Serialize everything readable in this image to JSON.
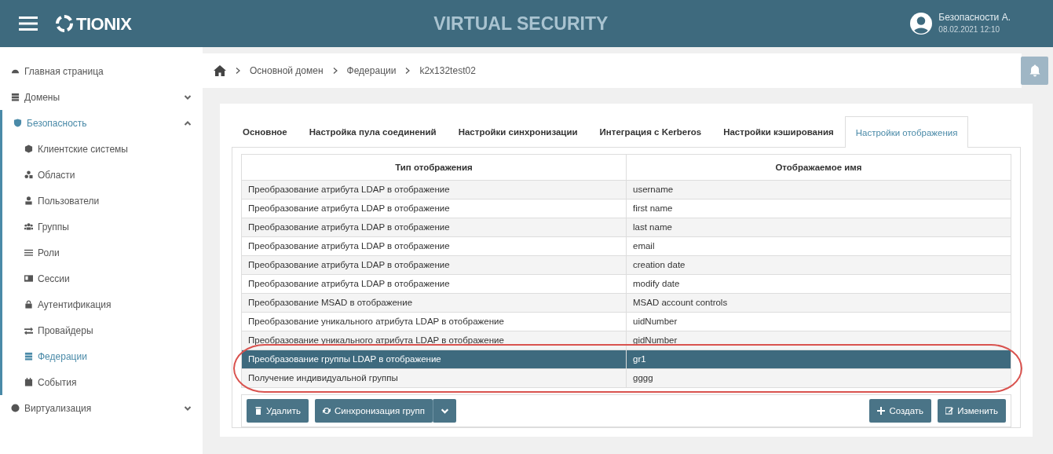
{
  "header": {
    "logo": "TIONIX",
    "title": "VIRTUAL SECURITY",
    "user": {
      "name": "Безопасности А.",
      "datetime": "08.02.2021 12:10"
    }
  },
  "sidebar": {
    "items": [
      {
        "kind": "link",
        "label": "Главная страница",
        "selected": false
      },
      {
        "kind": "group",
        "label": "Домены",
        "expanded": false
      },
      {
        "kind": "group",
        "label": "Безопасность",
        "expanded": true,
        "children": [
          {
            "label": "Клиентские системы",
            "selected": false
          },
          {
            "label": "Области",
            "selected": false
          },
          {
            "label": "Пользователи",
            "selected": false
          },
          {
            "label": "Группы",
            "selected": false
          },
          {
            "label": "Роли",
            "selected": false
          },
          {
            "label": "Сессии",
            "selected": false
          },
          {
            "label": "Аутентификация",
            "selected": false
          },
          {
            "label": "Провайдеры",
            "selected": false
          },
          {
            "label": "Федерации",
            "selected": true
          },
          {
            "label": "События",
            "selected": false
          }
        ]
      },
      {
        "kind": "group",
        "label": "Виртуализация",
        "expanded": false
      }
    ]
  },
  "breadcrumb": [
    "Основной домен",
    "Федерации",
    "k2x132test02"
  ],
  "tabs": [
    {
      "label": "Основное",
      "selected": false
    },
    {
      "label": "Настройка пула соединений",
      "selected": false
    },
    {
      "label": "Настройки синхронизации",
      "selected": false
    },
    {
      "label": "Интеграция с Kerberos",
      "selected": false
    },
    {
      "label": "Настройки кэширования",
      "selected": false
    },
    {
      "label": "Настройки отображения",
      "selected": true
    }
  ],
  "table": {
    "columns": [
      "Тип отображения",
      "Отображаемое имя"
    ],
    "rows": [
      {
        "cells": [
          "Преобразование атрибута LDAP в отображение",
          "username"
        ],
        "selected": false,
        "circled": false
      },
      {
        "cells": [
          "Преобразование атрибута LDAP в отображение",
          "first name"
        ],
        "selected": false,
        "circled": false
      },
      {
        "cells": [
          "Преобразование атрибута LDAP в отображение",
          "last name"
        ],
        "selected": false,
        "circled": false
      },
      {
        "cells": [
          "Преобразование атрибута LDAP в отображение",
          "email"
        ],
        "selected": false,
        "circled": false
      },
      {
        "cells": [
          "Преобразование атрибута LDAP в отображение",
          "creation date"
        ],
        "selected": false,
        "circled": false
      },
      {
        "cells": [
          "Преобразование атрибута LDAP в отображение",
          "modify date"
        ],
        "selected": false,
        "circled": false
      },
      {
        "cells": [
          "Преобразование MSAD в отображение",
          "MSAD account controls"
        ],
        "selected": false,
        "circled": false
      },
      {
        "cells": [
          "Преобразование уникального атрибута LDAP в отображение",
          "uidNumber"
        ],
        "selected": false,
        "circled": false
      },
      {
        "cells": [
          "Преобразование уникального атрибута LDAP в отображение",
          "gidNumber"
        ],
        "selected": false,
        "circled": false
      },
      {
        "cells": [
          "Преобразование группы LDAP в отображение",
          "gr1"
        ],
        "selected": true,
        "circled": true
      },
      {
        "cells": [
          "Получение индивидуальной группы",
          "gggg"
        ],
        "selected": false,
        "circled": true
      }
    ]
  },
  "actions_left": [
    {
      "kind": "delete",
      "label": "Удалить"
    },
    {
      "kind": "sync-split",
      "label": "Синхронизация групп"
    }
  ],
  "actions_right": [
    {
      "kind": "create",
      "label": "Создать"
    },
    {
      "kind": "edit",
      "label": "Изменить"
    }
  ]
}
